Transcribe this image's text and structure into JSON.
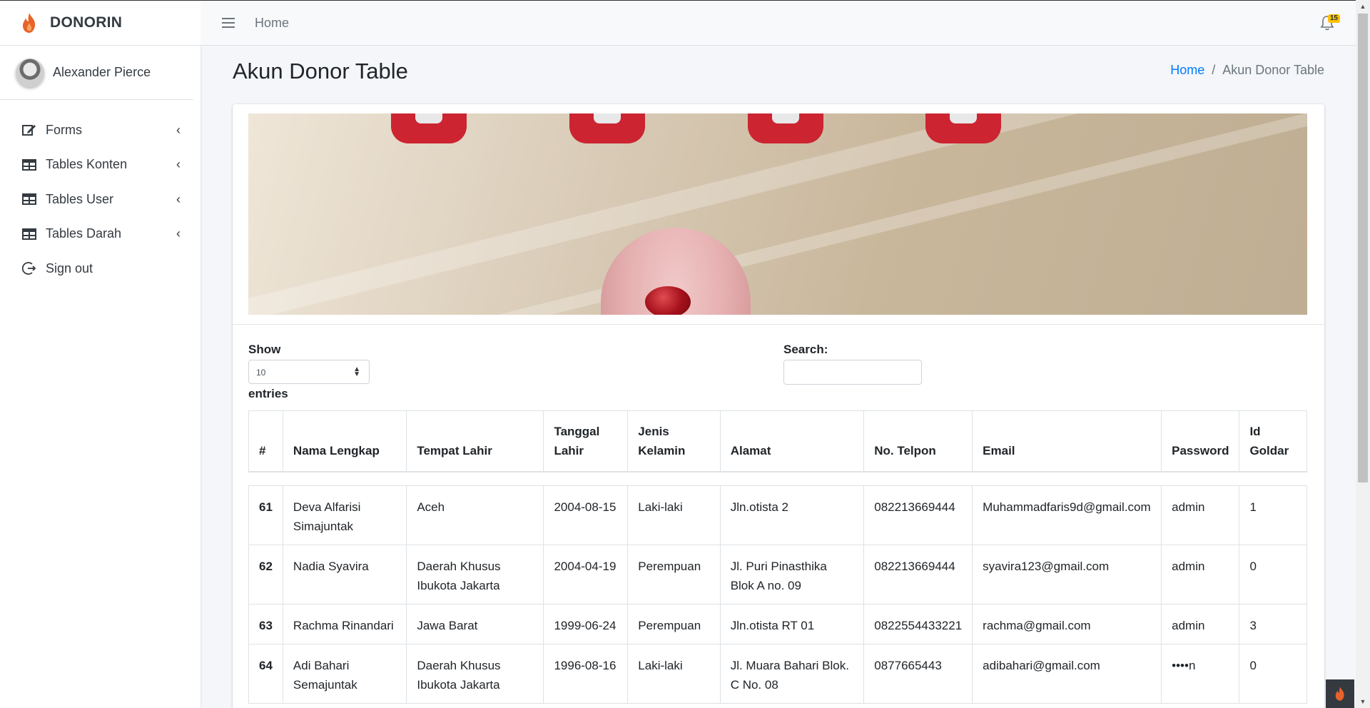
{
  "sidebar": {
    "brand": "DONORIN",
    "user_name": "Alexander Pierce",
    "items": [
      {
        "label": "Forms",
        "icon": "edit-icon"
      },
      {
        "label": "Tables Konten",
        "icon": "table-icon"
      },
      {
        "label": "Tables User",
        "icon": "table-icon"
      },
      {
        "label": "Tables Darah",
        "icon": "table-icon"
      },
      {
        "label": "Sign out",
        "icon": "sign-out-icon"
      }
    ]
  },
  "topbar": {
    "home_label": "Home",
    "notification_count": "15"
  },
  "page": {
    "title": "Akun Donor Table",
    "breadcrumb_home": "Home",
    "breadcrumb_sep": "/",
    "breadcrumb_current": "Akun Donor Table"
  },
  "controls": {
    "show_label": "Show",
    "entries_value": "10",
    "entries_label": "entries",
    "search_label": "Search:"
  },
  "table": {
    "headers": [
      "#",
      "Nama Lengkap",
      "Tempat Lahir",
      "Tanggal Lahir",
      "Jenis Kelamin",
      "Alamat",
      "No. Telpon",
      "Email",
      "Password",
      "Id Goldar"
    ],
    "rows": [
      [
        "61",
        "Deva Alfarisi Simajuntak",
        "Aceh",
        "2004-08-15",
        "Laki-laki",
        "Jln.otista 2",
        "082213669444",
        "Muhammadfaris9d@gmail.com",
        "admin",
        "1"
      ],
      [
        "62",
        "Nadia Syavira",
        "Daerah Khusus Ibukota Jakarta",
        "2004-04-19",
        "Perempuan",
        "Jl. Puri Pinasthika Blok A no. 09",
        "082213669444",
        "syavira123@gmail.com",
        "admin",
        "0"
      ],
      [
        "63",
        "Rachma Rinandari",
        "Jawa Barat",
        "1999-06-24",
        "Perempuan",
        "Jln.otista RT 01",
        "0822554433221",
        "rachma@gmail.com",
        "admin",
        "3"
      ],
      [
        "64",
        "Adi Bahari Semajuntak",
        "Daerah Khusus Ibukota Jakarta",
        "1996-08-16",
        "Laki-laki",
        "Jl. Muara Bahari Blok. C No. 08",
        "0877665443",
        "adibahari@gmail.com",
        "••••n",
        "0"
      ]
    ]
  },
  "colors": {
    "link": "#007bff",
    "brand_flame": "#e8632b",
    "badge": "#ffc107"
  }
}
